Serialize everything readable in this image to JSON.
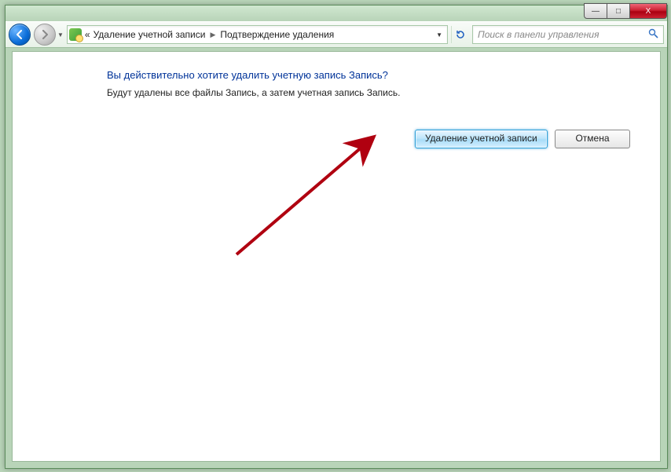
{
  "window_controls": {
    "min": "—",
    "max": "□",
    "close": "X"
  },
  "breadcrumb": {
    "chevrons": "«",
    "part1": "Удаление учетной записи",
    "part2": "Подтверждение удаления"
  },
  "search": {
    "placeholder": "Поиск в панели управления"
  },
  "content": {
    "heading": "Вы действительно хотите удалить учетную запись Запись?",
    "body": "Будут удалены все файлы Запись, а затем учетная запись Запись.",
    "delete_btn": "Удаление учетной записи",
    "cancel_btn": "Отмена"
  }
}
